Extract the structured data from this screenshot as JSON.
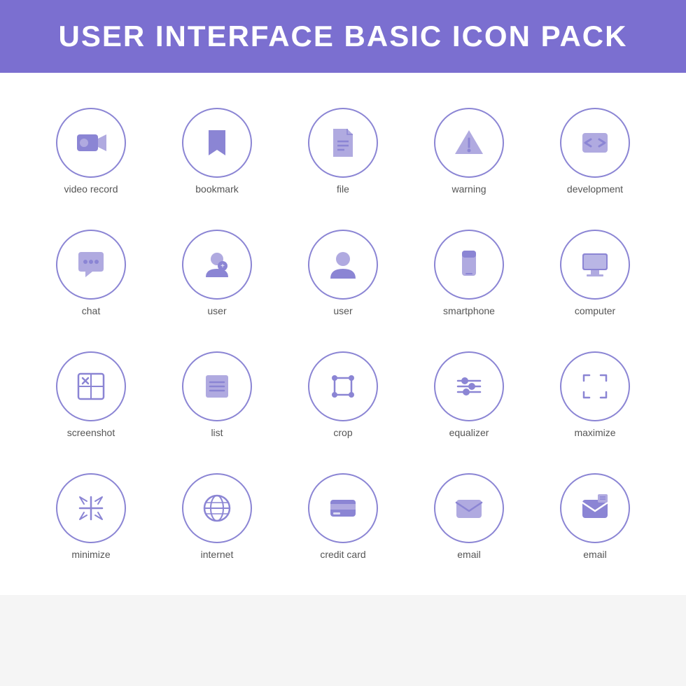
{
  "header": {
    "title": "USER INTERFACE BASIC ICON PACK"
  },
  "rows": [
    [
      {
        "id": "video-record",
        "label": "video record"
      },
      {
        "id": "bookmark",
        "label": "bookmark"
      },
      {
        "id": "file",
        "label": "file"
      },
      {
        "id": "warning",
        "label": "warning"
      },
      {
        "id": "development",
        "label": "development"
      }
    ],
    [
      {
        "id": "chat",
        "label": "chat"
      },
      {
        "id": "user1",
        "label": "user"
      },
      {
        "id": "user2",
        "label": "user"
      },
      {
        "id": "smartphone",
        "label": "smartphone"
      },
      {
        "id": "computer",
        "label": "computer"
      }
    ],
    [
      {
        "id": "screenshot",
        "label": "screenshot"
      },
      {
        "id": "list",
        "label": "list"
      },
      {
        "id": "crop",
        "label": "crop"
      },
      {
        "id": "equalizer",
        "label": "equalizer"
      },
      {
        "id": "maximize",
        "label": "maximize"
      }
    ],
    [
      {
        "id": "minimize",
        "label": "minimize"
      },
      {
        "id": "internet",
        "label": "internet"
      },
      {
        "id": "credit-card",
        "label": "credit card"
      },
      {
        "id": "email1",
        "label": "email"
      },
      {
        "id": "email2",
        "label": "email"
      }
    ]
  ],
  "colors": {
    "accent": "#8b85d4",
    "accent_light": "#b0aae0",
    "header_bg": "#7b6fd0",
    "header_text": "#ffffff"
  }
}
